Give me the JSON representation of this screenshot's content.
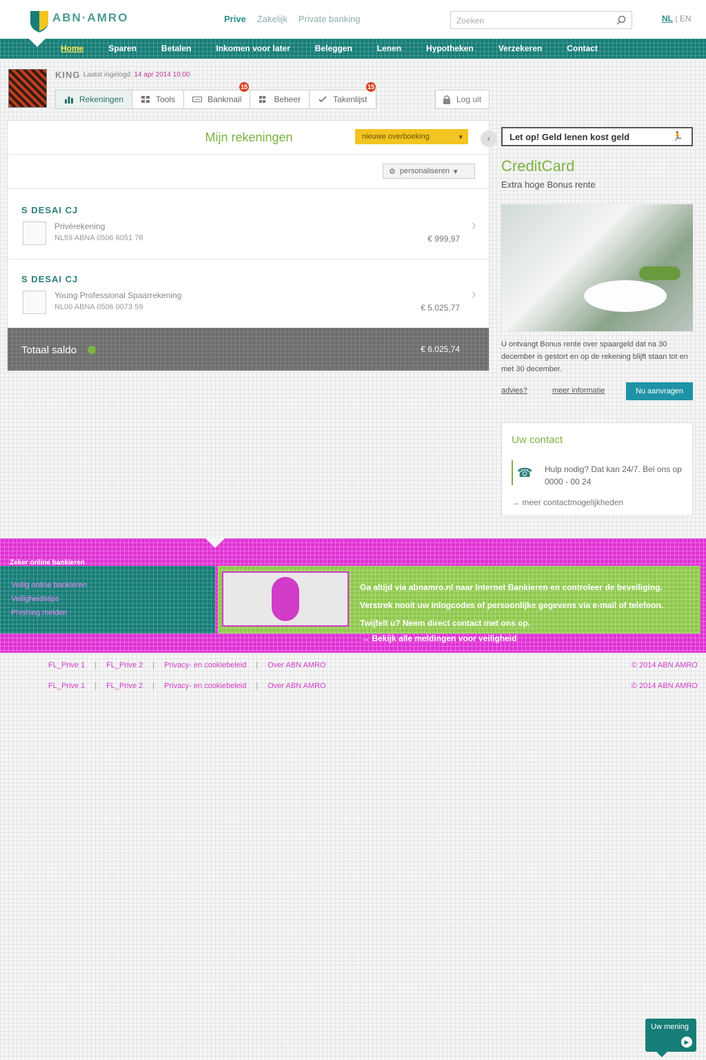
{
  "header": {
    "logo_text": "ABN·AMRO",
    "segments": [
      "Prive",
      "Zakelijk",
      "Private banking"
    ],
    "active_segment": "Prive",
    "search_placeholder": "Zoeken",
    "lang_nl": "NL",
    "lang_sep": "|",
    "lang_en": "EN"
  },
  "mainnav": {
    "items": [
      "Home",
      "Sparen",
      "Betalen",
      "Inkomen voor later",
      "Beleggen",
      "Lenen",
      "Hypotheken",
      "Verzekeren",
      "Contact"
    ],
    "active": "Home"
  },
  "user": {
    "name": "KING",
    "last_login_label": "Laatst ingelogd:",
    "last_login_date": "14 apr 2014 10:00"
  },
  "tabs": [
    {
      "label": "Rekeningen",
      "icon": "bar-chart-icon",
      "badge": ""
    },
    {
      "label": "Tools",
      "icon": "grid-icon",
      "badge": ""
    },
    {
      "label": "Bankmail",
      "icon": "keyboard-icon",
      "badge": "15"
    },
    {
      "label": "Beheer",
      "icon": "sliders-icon",
      "badge": ""
    },
    {
      "label": "Takenlijst",
      "icon": "checkmark-icon",
      "badge": "15"
    }
  ],
  "logout_label": "Log uit",
  "accounts": {
    "title": "Mijn rekeningen",
    "new_transfer_label": "nieuwe overboeking",
    "personalize_label": "personaliseren",
    "items": [
      {
        "holder": "S DESAI CJ",
        "type": "Privérekening",
        "iban": "NL59 ABNA 0506 6051 78",
        "amount": "€ 999,97"
      },
      {
        "holder": "S DESAI CJ",
        "type": "Young Professional Spaarrekening",
        "iban": "NL00 ABNA 0506 0073 59",
        "amount": "€ 5.025,77"
      }
    ],
    "total_label": "Totaal saldo",
    "total_value": "€ 6.025,74"
  },
  "sidebar": {
    "banner": "Let op! Geld lenen kost geld",
    "cc_title": "CreditCard",
    "cc_subtitle": "Extra hoge Bonus rente",
    "cc_text": "U ontvangt Bonus rente over spaargeld dat na 30 december is gestort en op de rekening blijft staan tot en met 30 december.",
    "link_advice": "advies?",
    "link_more": "meer informatie",
    "apply_button": "Nu aanvragen",
    "contact_title": "Uw contact",
    "contact_text": "Hulp nodig? Dat kan 24/7. Bel ons op 0000 - 00 24",
    "contact_more": "meer contactmogelijkheden"
  },
  "footer": {
    "left_heading": "Zeker online bankieren",
    "left_links": [
      "Veilig online bankieren",
      "Veiligheidstips",
      "Phishing melden"
    ],
    "promo_text": "Ga altijd via abnamro.nl naar Internet Bankieren en controleer de beveiliging. Verstrek nooit uw inlogcodes of persoonlijke gegevens via e-mail of telefoon. Twijfelt u? Neem direct contact met ons op.",
    "promo_link": "Bekijk alle meldingen voor veiligheid",
    "bottom_rows": [
      {
        "links": [
          "FL_Prive 1",
          "FL_Prive 2",
          "Privacy- en cookiebeleid",
          "Over ABN AMRO"
        ],
        "copyright": "© 2014 ABN AMRO"
      },
      {
        "links": [
          "FL_Prive 1",
          "FL_Prive 2",
          "Privacy- en cookiebeleid",
          "Over ABN AMRO"
        ],
        "copyright": "© 2014 ABN AMRO"
      }
    ]
  },
  "opinion_widget": {
    "label": "Uw mening"
  },
  "colors": {
    "brand_teal": "#177e77",
    "accent_green": "#7cb342",
    "accent_yellow": "#f2c420",
    "accent_magenta": "#e033d5"
  }
}
